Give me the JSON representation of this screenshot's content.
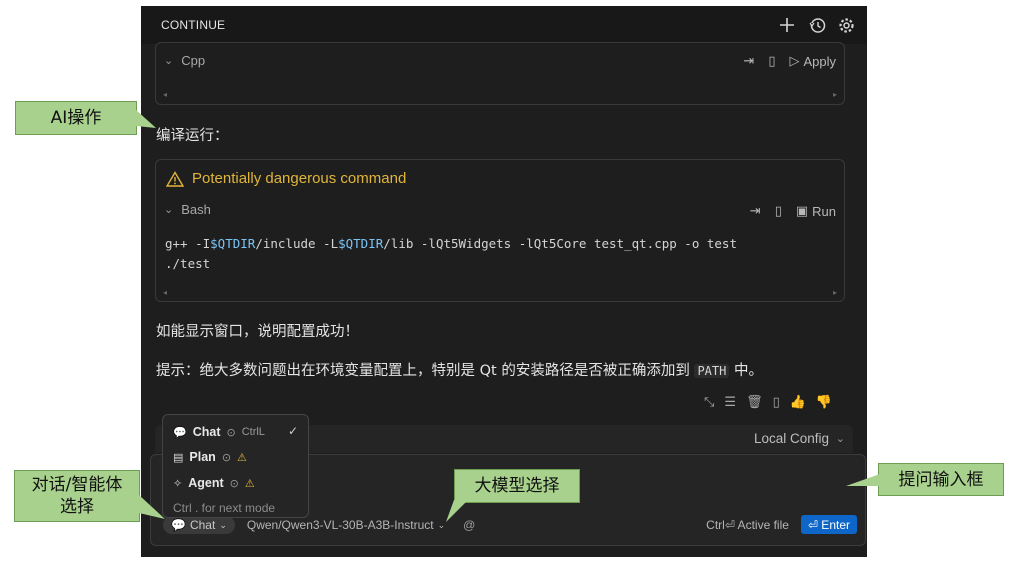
{
  "panel": {
    "title": "CONTINUE",
    "icons": [
      "plus-icon",
      "history-icon",
      "gear-icon"
    ]
  },
  "code_block_1": {
    "language": "Cpp",
    "apply_label": "Apply"
  },
  "message_1": "编译运行：",
  "code_block_2": {
    "warning": "Potentially dangerous command",
    "language": "Bash",
    "run_label": "Run",
    "line1_parts": [
      "g++ -I",
      "$QTDIR",
      "/include -L",
      "$QTDIR",
      "/lib -lQt5Widgets -lQt5Core test_qt.cpp -o test"
    ],
    "line2": "./test"
  },
  "message_2": "如能显示窗口，说明配置成功！",
  "message_3": {
    "before": "提示：绝大多数问题出在环境变量配置上，特别是 Qt 的安装路径是否被正确添加到 ",
    "code": "PATH",
    "after": " 中。"
  },
  "config": {
    "label": "Local Config"
  },
  "mode_menu": {
    "items": [
      {
        "label": "Chat",
        "shortcut": "CtrlL",
        "selected": true
      },
      {
        "label": "Plan"
      },
      {
        "label": "Agent"
      }
    ],
    "footer": "Ctrl . for next mode"
  },
  "input": {
    "mode_label": "Chat",
    "model_label": "Qwen/Qwen3-VL-30B-A3B-Instruct",
    "at_symbol": "@",
    "active_file_label": "Ctrl⏎ Active file",
    "enter_label": "⏎ Enter"
  },
  "annotations": {
    "ai_ops": "AI操作",
    "mode_select": "对话/智能体\n选择",
    "model_select": "大模型选择",
    "input_box": "提问输入框"
  },
  "colors": {
    "panel_bg": "#1e1e1e",
    "warning": "#e0b53a",
    "enter_button": "#0e66c8",
    "annotation_fill": "#a8d18d"
  }
}
